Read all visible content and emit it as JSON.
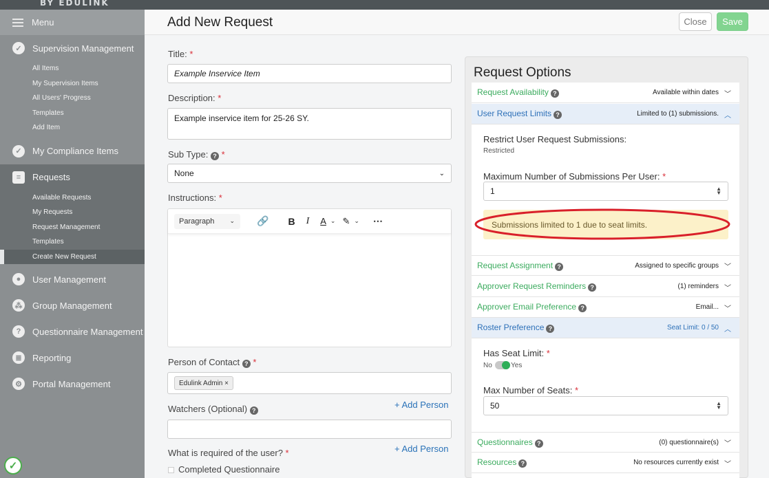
{
  "brand": "BY EDULINK",
  "sidebar": {
    "menu_label": "Menu",
    "supervision": {
      "label": "Supervision Management",
      "items": [
        "All Items",
        "My Supervision Items",
        "All Users' Progress",
        "Templates",
        "Add Item"
      ]
    },
    "compliance": {
      "label": "My Compliance Items"
    },
    "requests": {
      "label": "Requests",
      "items": [
        "Available Requests",
        "My Requests",
        "Request Management",
        "Templates",
        "Create New Request"
      ]
    },
    "user_mgmt": "User Management",
    "group_mgmt": "Group Management",
    "questionnaire_mgmt": "Questionnaire Management",
    "reporting": "Reporting",
    "portal_mgmt": "Portal Management"
  },
  "header": {
    "title": "Add New Request",
    "close_label": "Close",
    "save_label": "Save"
  },
  "form": {
    "title_label": "Title:",
    "title_value": "Example Inservice Item",
    "description_label": "Description:",
    "description_value": "Example inservice item for 25-26 SY.",
    "subtype_label": "Sub Type:",
    "subtype_value": "None",
    "instructions_label": "Instructions:",
    "editor_paragraph": "Paragraph",
    "contact_label": "Person of Contact",
    "contact_tag": "Edulink Admin",
    "add_person_1": "+ Add Person",
    "watchers_label": "Watchers (Optional)",
    "add_person_2": "+ Add Person",
    "required_label": "What is required of the user?",
    "completed_questionnaire": "Completed Questionnaire",
    "required_marker": "*"
  },
  "options": {
    "title": "Request Options",
    "availability": {
      "label": "Request Availability",
      "value": "Available within dates"
    },
    "user_limits": {
      "label": "User Request Limits",
      "value": "Limited to (1) submissions."
    },
    "restrict_label": "Restrict User Request Submissions:",
    "restrict_value": "Restricted",
    "max_sub_label": "Maximum Number of Submissions Per User:",
    "max_sub_value": "1",
    "notice": "Submissions limited to 1 due to seat limits.",
    "assignment": {
      "label": "Request Assignment",
      "value": "Assigned to specific groups"
    },
    "reminders": {
      "label": "Approver Request Reminders",
      "value": "(1) reminders"
    },
    "email_pref": {
      "label": "Approver Email Preference",
      "value": "Email..."
    },
    "roster": {
      "label": "Roster Preference",
      "value": "Seat Limit: 0 / 50"
    },
    "seat_limit_label": "Has Seat Limit:",
    "toggle_no": "No",
    "toggle_yes": "Yes",
    "max_seats_label": "Max Number of Seats:",
    "max_seats_value": "50",
    "questionnaires": {
      "label": "Questionnaires",
      "value": "(0) questionnaire(s)"
    },
    "resources": {
      "label": "Resources",
      "value": "No resources currently exist"
    }
  },
  "colors": {
    "accent_green": "#3bab5e",
    "accent_blue": "#2d70b8",
    "required_red": "#d9303a",
    "highlight_circle": "#d9202a"
  }
}
